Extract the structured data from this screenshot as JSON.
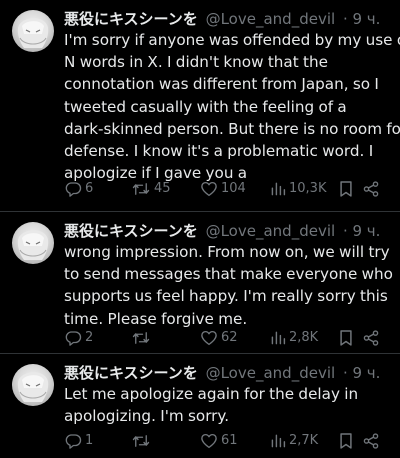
{
  "tweets": [
    {
      "display_name": "悪役にキスシーンを",
      "handle": "@Love_and_devil",
      "time": "· 9 ч.",
      "lines": [
        "I'm sorry if anyone was offended by my use of",
        "N words in X. I didn't know that the",
        "connotation was different from Japan, so I",
        "tweeted casually with the feeling of a",
        "dark-skinned person. But there is no room for",
        "defense. I know it's a problematic word. I",
        "apologize if I gave you a"
      ],
      "replies": "6",
      "reposts": "45",
      "likes": "104",
      "views": "10,3K"
    },
    {
      "display_name": "悪役にキスシーンを",
      "handle": "@Love_and_devil",
      "time": "· 9 ч.",
      "lines": [
        "wrong impression. From now on, we will try",
        "to send messages that make everyone who",
        "supports us feel happy. I'm really sorry this",
        "time. Please forgive me."
      ],
      "replies": "2",
      "reposts": "",
      "likes": "62",
      "views": "2,8K"
    },
    {
      "display_name": "悪役にキスシーンを",
      "handle": "@Love_and_devil",
      "time": "· 9 ч.",
      "lines": [
        "Let me apologize again for the delay in",
        "apologizing. I'm sorry."
      ],
      "replies": "1",
      "reposts": "",
      "likes": "61",
      "views": "2,7K"
    }
  ],
  "icons": {
    "reply": "reply-icon",
    "repost": "repost-icon",
    "like": "heart-icon",
    "views": "views-chart-icon",
    "bookmark": "bookmark-icon",
    "share": "share-icon"
  },
  "colors": {
    "background": "#000000",
    "text": "#e7e9ea",
    "secondary": "#71767b",
    "divider": "#2f3336"
  }
}
